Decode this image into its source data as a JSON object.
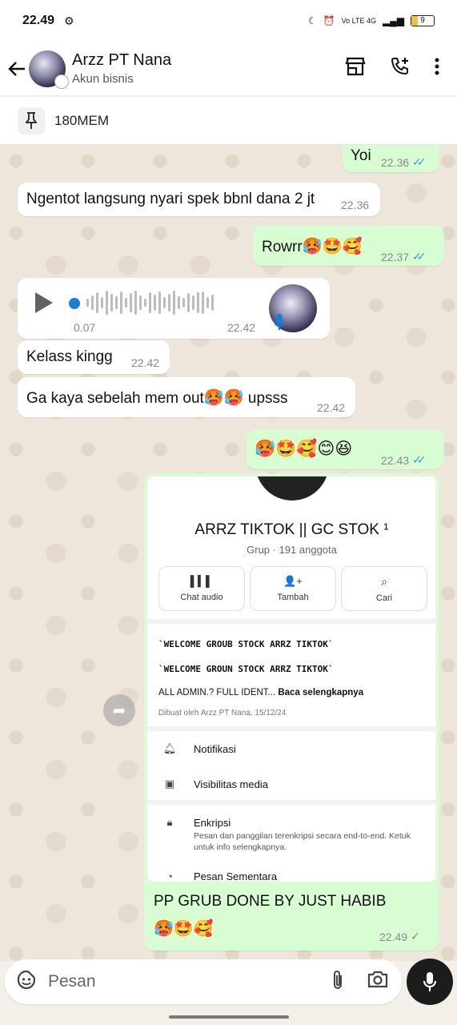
{
  "status": {
    "time": "22.49",
    "network": "Vo LTE 4G",
    "battery": "9"
  },
  "header": {
    "title": "Arzz PT Nana",
    "subtitle": "Akun bisnis"
  },
  "pinned": {
    "text": "180MEM"
  },
  "messages": [
    {
      "dir": "out",
      "text": "Yoi",
      "time": "22.36"
    },
    {
      "dir": "in",
      "text": "Ngentot langsung nyari spek bbnl dana 2 jt",
      "time": "22.36"
    },
    {
      "dir": "out",
      "text": "Rowrr",
      "emoji": "🥵🤩🥰",
      "time": "22.37"
    },
    {
      "dir": "in",
      "type": "voice",
      "elapsed": "0.07",
      "time": "22.42"
    },
    {
      "dir": "in",
      "text": "Kelass kingg",
      "time": "22.42"
    },
    {
      "dir": "in",
      "text": "Ga kaya sebelah mem out",
      "emoji": "🥵🥵",
      "text2": " upsss",
      "time": "22.42"
    },
    {
      "dir": "out",
      "emoji": "🥵🤩🥰😊😆",
      "time": "22.43"
    },
    {
      "dir": "out",
      "type": "image",
      "caption": "PP GRUB DONE BY JUST HABIB",
      "caption_emoji": "🥵🤩🥰",
      "time": "22.49"
    }
  ],
  "group_shot": {
    "name": "ARRZ TIKTOK || GC STOK ¹",
    "sub": "Grup · 191 anggota",
    "actions": [
      "Chat audio",
      "Tambah",
      "Cari"
    ],
    "desc1": "`WELCOME GROUB STOCK ARRZ TIKTOK`",
    "desc2": "`WELCOME GROUN STOCK ARRZ TIKTOK`",
    "desc3": "ALL ADMIN.? FULL IDENT...",
    "read_more": "Baca selengkapnya",
    "created": "Dibuat oleh Arzz PT Nana, 15/12/24",
    "rows": [
      "Notifikasi",
      "Visibilitas media",
      "Enkripsi",
      "Pesan Sementara"
    ],
    "enc_desc": "Pesan dan panggilan terenkripsi secara end-to-end. Ketuk untuk info selengkapnya."
  },
  "input": {
    "placeholder": "Pesan"
  },
  "colors": {
    "outgoing": "#d9fdd3",
    "incoming": "#ffffff",
    "tick_read": "#3a9bdc",
    "mic_button": "#1c1c1c"
  }
}
